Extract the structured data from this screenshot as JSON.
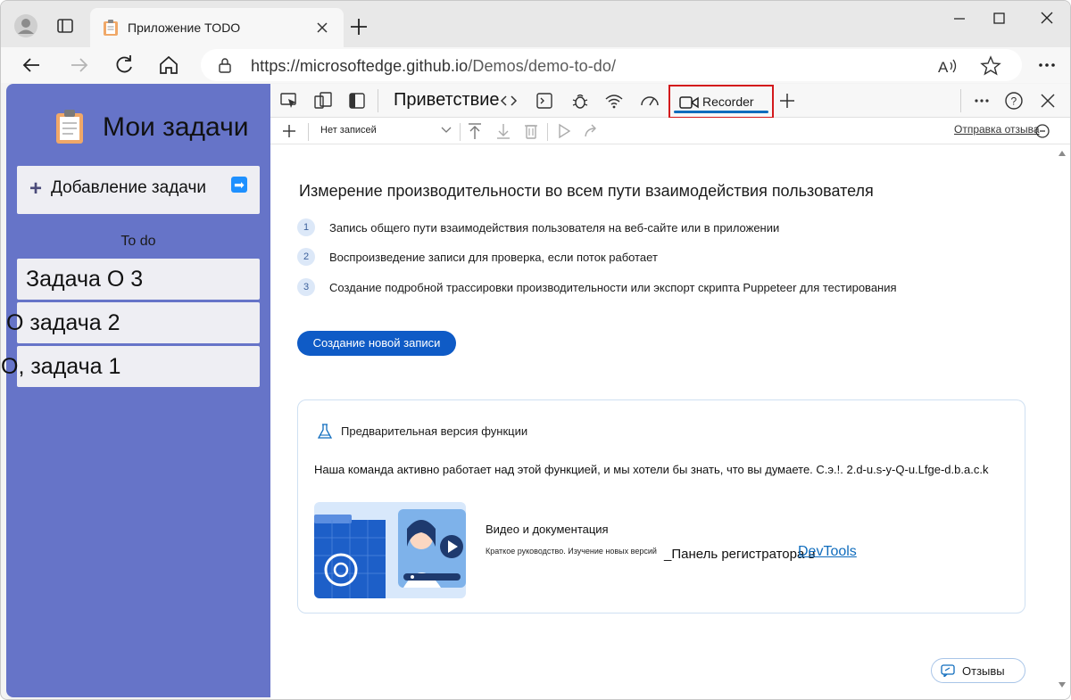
{
  "browser": {
    "tab_title": "Приложение TODO",
    "url_host": "https://microsoftedge.github.io",
    "url_path": "/Demos/demo-to-do/"
  },
  "app": {
    "title": "Мои задачи",
    "add_task_label": "Добавление задачи",
    "todo_heading": "To do",
    "tasks": [
      {
        "text": "Задача О 3"
      },
      {
        "text": "О задача 2"
      },
      {
        "text": "О, задача 1"
      }
    ]
  },
  "devtools": {
    "welcome_tab": "Приветствие",
    "recorder_tab": "Recorder",
    "recording_select": "Нет записей",
    "send_feedback_link": "Отправка отзыва",
    "headline": "Измерение производительности во всем пути взаимодействия пользователя",
    "steps": [
      {
        "num": "1",
        "text": "Запись общего пути взаимодействия пользователя на веб-сайте или в приложении"
      },
      {
        "num": "2",
        "text": "Воспроизведение записи для проверка, если поток работает"
      },
      {
        "num": "3",
        "text": "Создание подробной трассировки производительности или экспорт скрипта Puppeteer для тестирования"
      }
    ],
    "create_button": "Создание новой записи",
    "card": {
      "preview_label": "Предварительная версия функции",
      "description": "Наша команда активно работает над этой функцией, и мы хотели бы знать, что вы думаете. С.э.!. 2.d-u.s-y-Q-u.Lfge-d.b.a.c.k",
      "video_title": "Видео и документация",
      "video_subtitle": "Краткое руководство. Изучение новых версий",
      "video_panel_text": "_Панель регистратора в",
      "video_link": "DevTools"
    },
    "feedback_button": "Отзывы"
  },
  "colors": {
    "app_background": "#6674c8",
    "accent": "#0f5bc6",
    "highlight_box": "#d3191c",
    "link": "#0f6cbd"
  }
}
